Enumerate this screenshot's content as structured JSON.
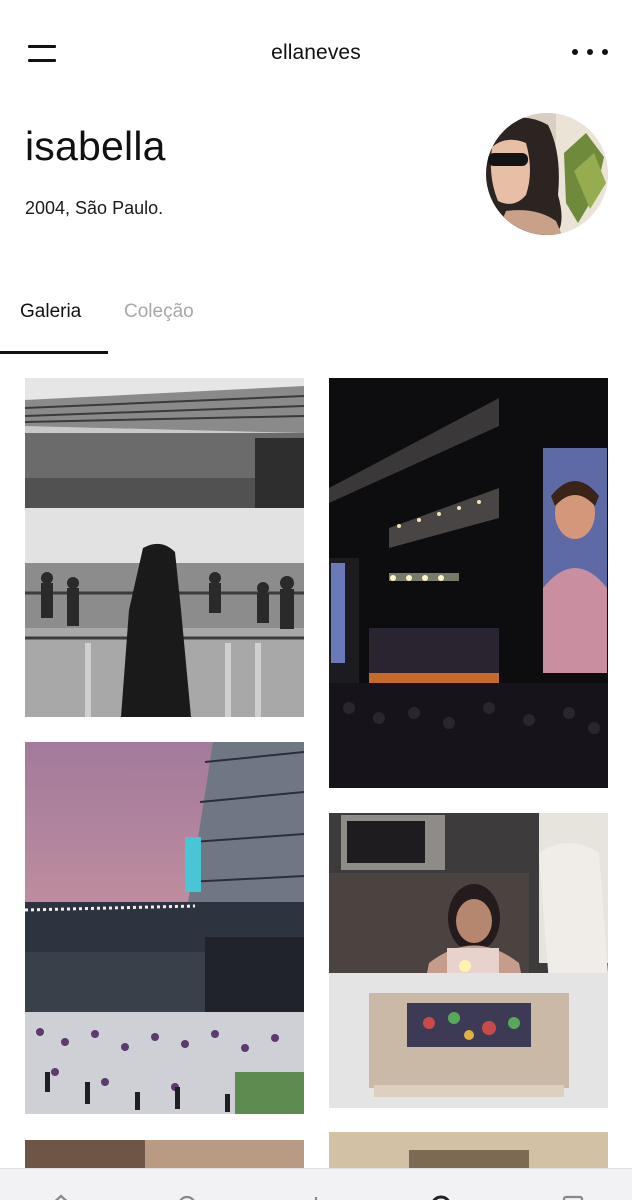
{
  "header": {
    "menu_icon": "hamburger-menu-icon",
    "username": "ellaneves",
    "more_icon": "more-dots-icon"
  },
  "profile": {
    "name": "isabella",
    "bio": "2004, São Paulo.",
    "avatar_icon": "avatar-photo"
  },
  "tabs": [
    {
      "label": "Galeria",
      "active": true
    },
    {
      "label": "Coleção",
      "active": false
    }
  ],
  "gallery": {
    "photos": [
      {
        "description_icon": "stadium-crowd-photo-bw"
      },
      {
        "description_icon": "concert-stage-photo"
      },
      {
        "description_icon": "stadium-sunset-photo"
      },
      {
        "description_icon": "birthday-cake-photo"
      },
      {
        "description_icon": "partial-photo"
      },
      {
        "description_icon": "partial-photo"
      }
    ]
  },
  "bottom_nav": {
    "icons": [
      "home-icon",
      "search-icon",
      "add-icon",
      "activity-icon",
      "profile-icon"
    ]
  },
  "colors": {
    "text": "#111111",
    "inactive_tab": "#a8a8a8",
    "background": "#ffffff"
  }
}
